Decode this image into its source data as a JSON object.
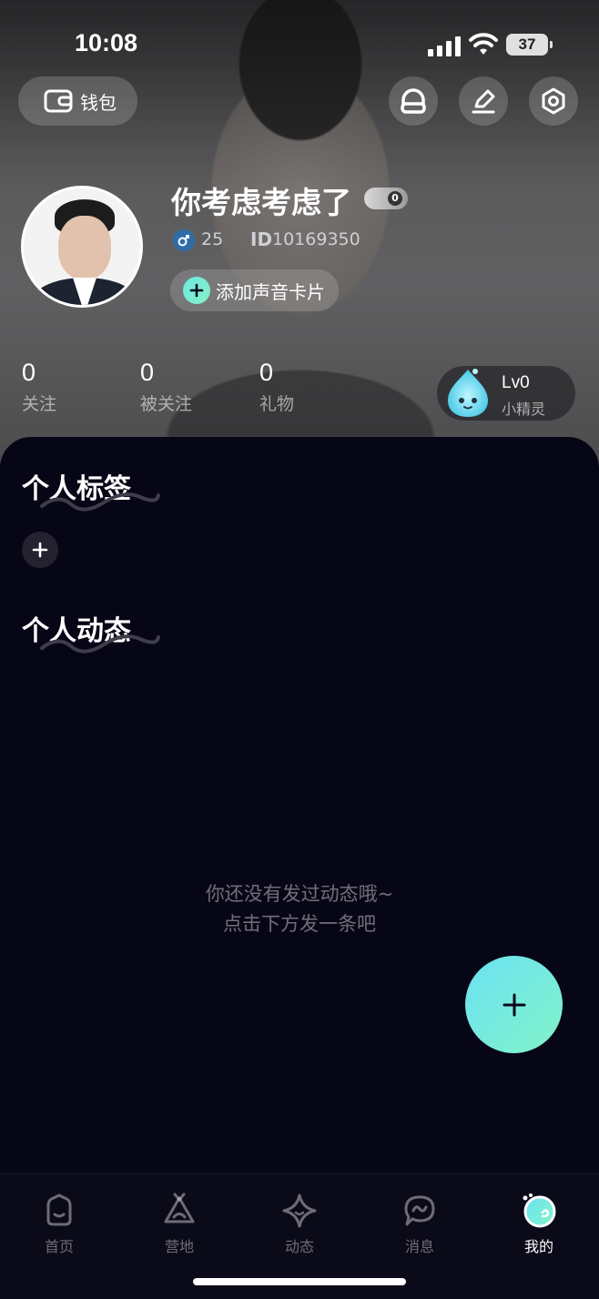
{
  "status_bar": {
    "time": "10:08",
    "battery": "37"
  },
  "header": {
    "wallet_label": "钱包"
  },
  "profile": {
    "nickname": "你考虑考虑了",
    "level_badge": "0",
    "age": "25",
    "id_label": "ID",
    "id_value": "10169350",
    "voice_card_label": "添加声音卡片"
  },
  "stats": [
    {
      "value": "0",
      "label": "关注"
    },
    {
      "value": "0",
      "label": "被关注"
    },
    {
      "value": "0",
      "label": "礼物"
    }
  ],
  "sprite": {
    "level": "Lv0",
    "name": "小精灵"
  },
  "sections": {
    "tags_title": "个人标签",
    "moments_title": "个人动态"
  },
  "empty_state": {
    "line1": "你还没有发过动态哦~",
    "line2": "点击下方发一条吧"
  },
  "tabs": [
    {
      "label": "首页",
      "icon": "home-icon"
    },
    {
      "label": "营地",
      "icon": "camp-icon"
    },
    {
      "label": "动态",
      "icon": "moments-icon"
    },
    {
      "label": "消息",
      "icon": "message-icon"
    },
    {
      "label": "我的",
      "icon": "me-icon",
      "active": true
    }
  ],
  "colors": {
    "background": "#070616",
    "accent_start": "#6ae2f3",
    "accent_end": "#83f3c9"
  }
}
